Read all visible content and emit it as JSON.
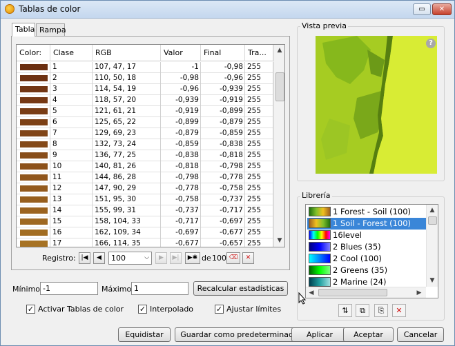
{
  "window": {
    "title": "Tablas de color",
    "minimize_label": "▭",
    "close_label": "✕"
  },
  "tabs": [
    {
      "label": "Tabla"
    },
    {
      "label": "Rampa"
    }
  ],
  "table": {
    "headers": [
      "Color:",
      "Clase",
      "RGB",
      "Valor",
      "Final",
      "Tra..."
    ],
    "rows": [
      {
        "clase": "1",
        "rgb": "107, 47, 17",
        "valor": "-1",
        "final": "-0,98",
        "tra": "255",
        "color": "#6b2f11"
      },
      {
        "clase": "2",
        "rgb": "110, 50, 18",
        "valor": "-0,98",
        "final": "-0,96",
        "tra": "255",
        "color": "#6e3212"
      },
      {
        "clase": "3",
        "rgb": "114, 54, 19",
        "valor": "-0,96",
        "final": "-0,939",
        "tra": "255",
        "color": "#723613"
      },
      {
        "clase": "4",
        "rgb": "118, 57, 20",
        "valor": "-0,939",
        "final": "-0,919",
        "tra": "255",
        "color": "#763914"
      },
      {
        "clase": "5",
        "rgb": "121, 61, 21",
        "valor": "-0,919",
        "final": "-0,899",
        "tra": "255",
        "color": "#793d15"
      },
      {
        "clase": "6",
        "rgb": "125, 65, 22",
        "valor": "-0,899",
        "final": "-0,879",
        "tra": "255",
        "color": "#7d4116"
      },
      {
        "clase": "7",
        "rgb": "129, 69, 23",
        "valor": "-0,879",
        "final": "-0,859",
        "tra": "255",
        "color": "#814517"
      },
      {
        "clase": "8",
        "rgb": "132, 73, 24",
        "valor": "-0,859",
        "final": "-0,838",
        "tra": "255",
        "color": "#844918"
      },
      {
        "clase": "9",
        "rgb": "136, 77, 25",
        "valor": "-0,838",
        "final": "-0,818",
        "tra": "255",
        "color": "#884d19"
      },
      {
        "clase": "10",
        "rgb": "140, 81, 26",
        "valor": "-0,818",
        "final": "-0,798",
        "tra": "255",
        "color": "#8c511a"
      },
      {
        "clase": "11",
        "rgb": "144, 86, 28",
        "valor": "-0,798",
        "final": "-0,778",
        "tra": "255",
        "color": "#90561c"
      },
      {
        "clase": "12",
        "rgb": "147, 90, 29",
        "valor": "-0,778",
        "final": "-0,758",
        "tra": "255",
        "color": "#935a1d"
      },
      {
        "clase": "13",
        "rgb": "151, 95, 30",
        "valor": "-0,758",
        "final": "-0,737",
        "tra": "255",
        "color": "#975f1e"
      },
      {
        "clase": "14",
        "rgb": "155, 99, 31",
        "valor": "-0,737",
        "final": "-0,717",
        "tra": "255",
        "color": "#9b631f"
      },
      {
        "clase": "15",
        "rgb": "158, 104, 33",
        "valor": "-0,717",
        "final": "-0,697",
        "tra": "255",
        "color": "#9e6821"
      },
      {
        "clase": "16",
        "rgb": "162, 109, 34",
        "valor": "-0,697",
        "final": "-0,677",
        "tra": "255",
        "color": "#a26d22"
      },
      {
        "clase": "17",
        "rgb": "166, 114, 35",
        "valor": "-0,677",
        "final": "-0,657",
        "tra": "255",
        "color": "#a67223"
      }
    ]
  },
  "nav": {
    "label": "Registro:",
    "value": "100",
    "of_label": "de",
    "total": "100"
  },
  "range": {
    "min_label": "Mínimo:",
    "min_value": "-1",
    "max_label": "Máximo:",
    "max_value": "1",
    "recalc_label": "Recalcular estadísticas"
  },
  "options": [
    {
      "label": "Activar Tablas de color",
      "checked": true
    },
    {
      "label": "Interpolado",
      "checked": true
    },
    {
      "label": "Ajustar límites",
      "checked": true
    }
  ],
  "preview": {
    "title": "Vista previa",
    "help_label": "?"
  },
  "library": {
    "title": "Librería",
    "items": [
      {
        "label": "1  Forest - Soil  (100)",
        "colors": [
          "#1f6f10",
          "#7fbf2a",
          "#f0c020",
          "#a06020"
        ]
      },
      {
        "label": "1  Soil - Forest  (100)",
        "colors": [
          "#a06020",
          "#f0c020",
          "#7fbf2a",
          "#1f6f10"
        ]
      },
      {
        "label": "16level",
        "colors": [
          "#0000ff",
          "#00ffff",
          "#00ff00",
          "#ffff00",
          "#ff0000",
          "#ff00ff"
        ]
      },
      {
        "label": "2  Blues  (35)",
        "colors": [
          "#000080",
          "#0000ff",
          "#8080ff"
        ]
      },
      {
        "label": "2  Cool  (100)",
        "colors": [
          "#00ffff",
          "#0080ff",
          "#0000ff"
        ]
      },
      {
        "label": "2  Greens  (35)",
        "colors": [
          "#006400",
          "#00ff00",
          "#80ff80"
        ]
      },
      {
        "label": "2  Marine  (24)",
        "colors": [
          "#004050",
          "#20a0a0",
          "#a0e0e0"
        ]
      }
    ]
  },
  "footer": {
    "equidistar": "Equidistar",
    "guardar": "Guardar como predeterminado",
    "aplicar": "Aplicar",
    "aceptar": "Aceptar",
    "cancelar": "Cancelar"
  }
}
